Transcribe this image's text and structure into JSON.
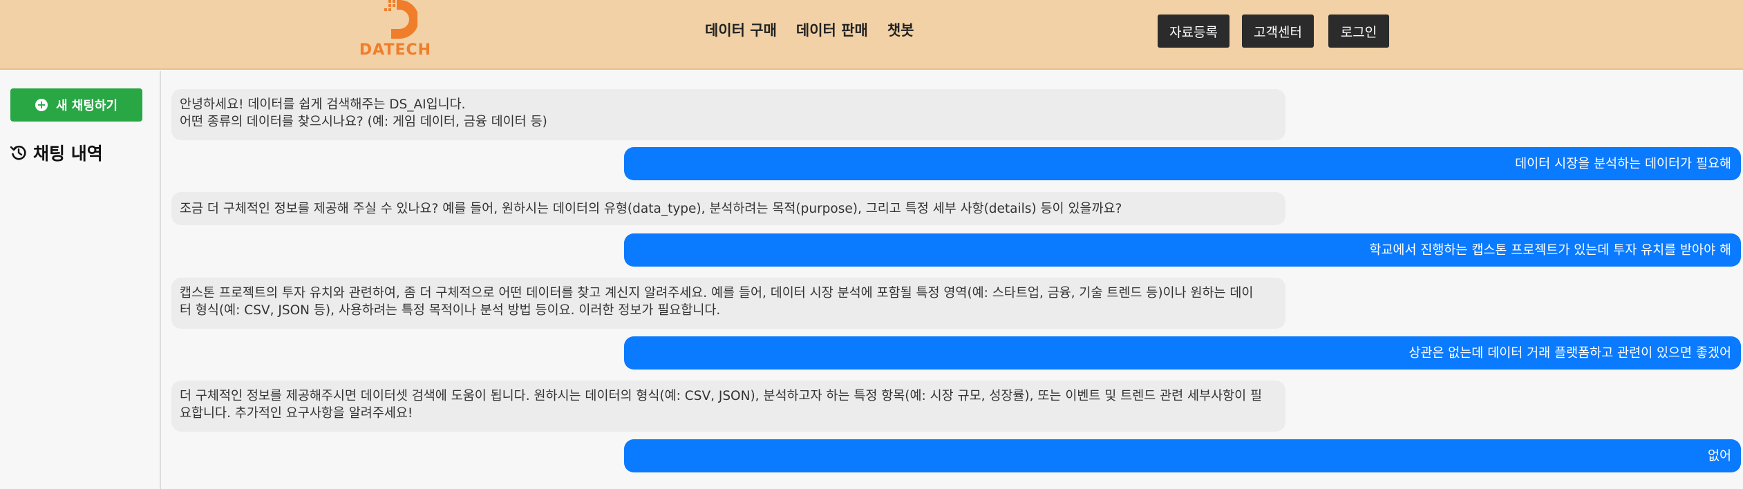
{
  "header": {
    "logo_text": "DATECH",
    "nav": [
      "데이터 구매",
      "데이터 판매",
      "챗봇"
    ],
    "buttons": {
      "upload": "자료등록",
      "support": "고객센터",
      "login": "로그인"
    }
  },
  "sidebar": {
    "new_chat_label": "새 채팅하기",
    "history_title": "채팅 내역"
  },
  "colors": {
    "header_bg": "#f1d1a5",
    "accent_orange": "#f07d2a",
    "user_bubble": "#0a7aff",
    "bot_bubble": "#ececec",
    "new_chat_green": "#29a745"
  },
  "messages": [
    {
      "role": "bot",
      "lines": [
        "안녕하세요! 데이터를 쉽게 검색해주는 DS_AI입니다.",
        "어떤 종류의 데이터를 찾으시나요? (예: 게임 데이터, 금융 데이터 등)"
      ]
    },
    {
      "role": "user",
      "text": "데이터 시장을 분석하는 데이터가 필요해"
    },
    {
      "role": "bot",
      "lines": [
        "조금 더 구체적인 정보를 제공해 주실 수 있나요? 예를 들어, 원하시는 데이터의 유형(data_type), 분석하려는 목적(purpose), 그리고 특정 세부 사항(details) 등이 있을까요?"
      ]
    },
    {
      "role": "user",
      "text": "학교에서 진행하는 캡스톤 프로젝트가 있는데 투자 유치를 받아야 해"
    },
    {
      "role": "bot",
      "lines": [
        "캡스톤 프로젝트의 투자 유치와 관련하여, 좀 더 구체적으로 어떤 데이터를 찾고 계신지 알려주세요. 예를 들어, 데이터 시장 분석에 포함될 특정 영역(예: 스타트업, 금융, 기술 트렌드 등)이나 원하는 데이",
        "터 형식(예: CSV, JSON 등), 사용하려는 특정 목적이나 분석 방법 등이요. 이러한 정보가 필요합니다."
      ]
    },
    {
      "role": "user",
      "text": "상관은 없는데 데이터 거래 플랫폼하고 관련이 있으면 좋겠어"
    },
    {
      "role": "bot",
      "lines": [
        "더 구체적인 정보를 제공해주시면 데이터셋 검색에 도움이 됩니다. 원하시는 데이터의 형식(예: CSV, JSON), 분석하고자 하는 특정 항목(예: 시장 규모, 성장률), 또는 이벤트 및 트렌드 관련 세부사항이 필",
        "요합니다. 추가적인 요구사항을 알려주세요!"
      ]
    },
    {
      "role": "user",
      "text": "없어"
    }
  ]
}
